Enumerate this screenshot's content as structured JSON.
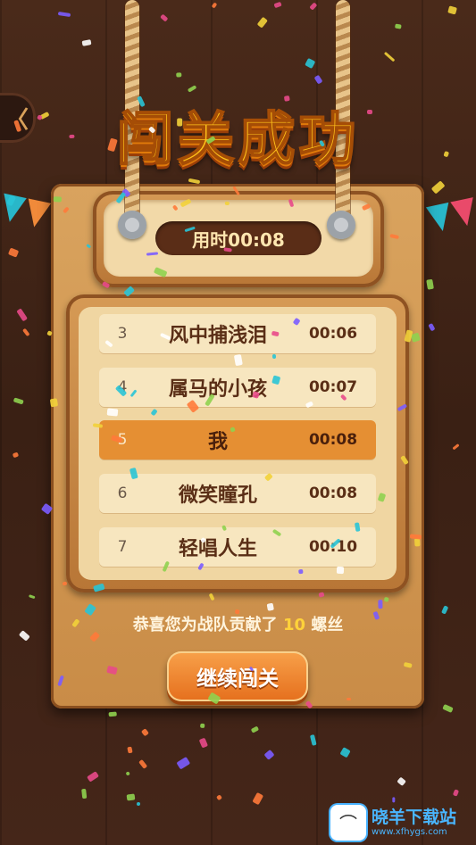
{
  "header": {
    "back_icon": "back-chevron-icon",
    "back_glyph": "〈",
    "title": "闯关成功"
  },
  "timer": {
    "label": "用时00:08"
  },
  "leaderboard": {
    "rows": [
      {
        "rank": "3",
        "name": "风中捕浅泪",
        "time": "00:06",
        "highlight": false
      },
      {
        "rank": "4",
        "name": "属马的小孩",
        "time": "00:07",
        "highlight": false
      },
      {
        "rank": "5",
        "name": "我",
        "time": "00:08",
        "highlight": true
      },
      {
        "rank": "6",
        "name": "微笑瞳孔",
        "time": "00:08",
        "highlight": false
      },
      {
        "rank": "7",
        "name": "轻唱人生",
        "time": "00:10",
        "highlight": false
      }
    ]
  },
  "reward": {
    "prefix": "恭喜您为战队贡献了",
    "amount": "10",
    "suffix": "螺丝"
  },
  "continue_button": {
    "label": "继续闯关"
  },
  "watermark": {
    "name": "晓羊下载站",
    "url": "www.xfhygs.com",
    "logo_glyph": "⌒"
  },
  "colors": {
    "title": "#ffc21a",
    "highlight_row": "#e58f33",
    "button": "#e56f1d",
    "background": "#3a2014"
  }
}
